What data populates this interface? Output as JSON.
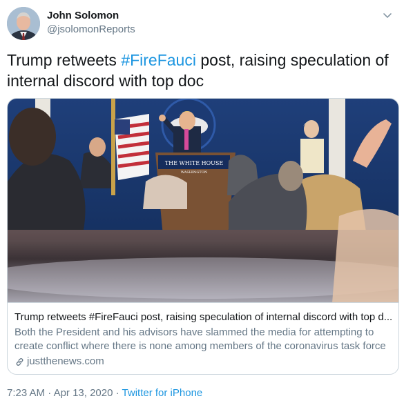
{
  "author": {
    "display_name": "John Solomon",
    "handle": "@jsolomonReports",
    "avatar_icon": "avatar-photo"
  },
  "tweet": {
    "text_before": "Trump retweets ",
    "hashtag": "#FireFauci",
    "text_after": " post, raising speculation of internal discord with top doc"
  },
  "card": {
    "image_icon": "press-briefing-photo",
    "podium_sign": "THE WHITE HOUSE",
    "podium_subsign": "WASHINGTON",
    "title": "Trump retweets #FireFauci post, raising speculation of internal discord with top d...",
    "description": "Both the President and his advisors have slammed the media for attempting to create conflict where there is none among members of the coronavirus task force",
    "domain": "justthenews.com"
  },
  "meta": {
    "time": "7:23 AM",
    "separator1": " · ",
    "date": "Apr 13, 2020",
    "separator2": " · ",
    "source": "Twitter for iPhone"
  },
  "colors": {
    "link": "#1b95e0",
    "secondary_text": "#657786",
    "border": "#ccd6dd"
  }
}
